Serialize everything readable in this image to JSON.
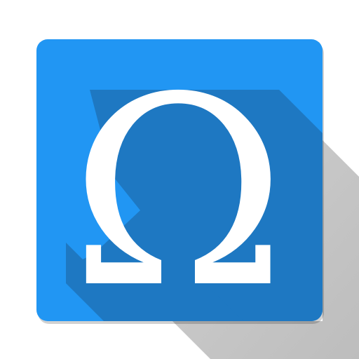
{
  "app_icon": {
    "glyph": "Ω",
    "glyph_icon_name": "omega-icon",
    "colors": {
      "tile": "#2196F3",
      "inner_shadow": "#1E78C2",
      "long_shadow": "#C6C6C6",
      "glyph": "#FFFFFF"
    }
  }
}
